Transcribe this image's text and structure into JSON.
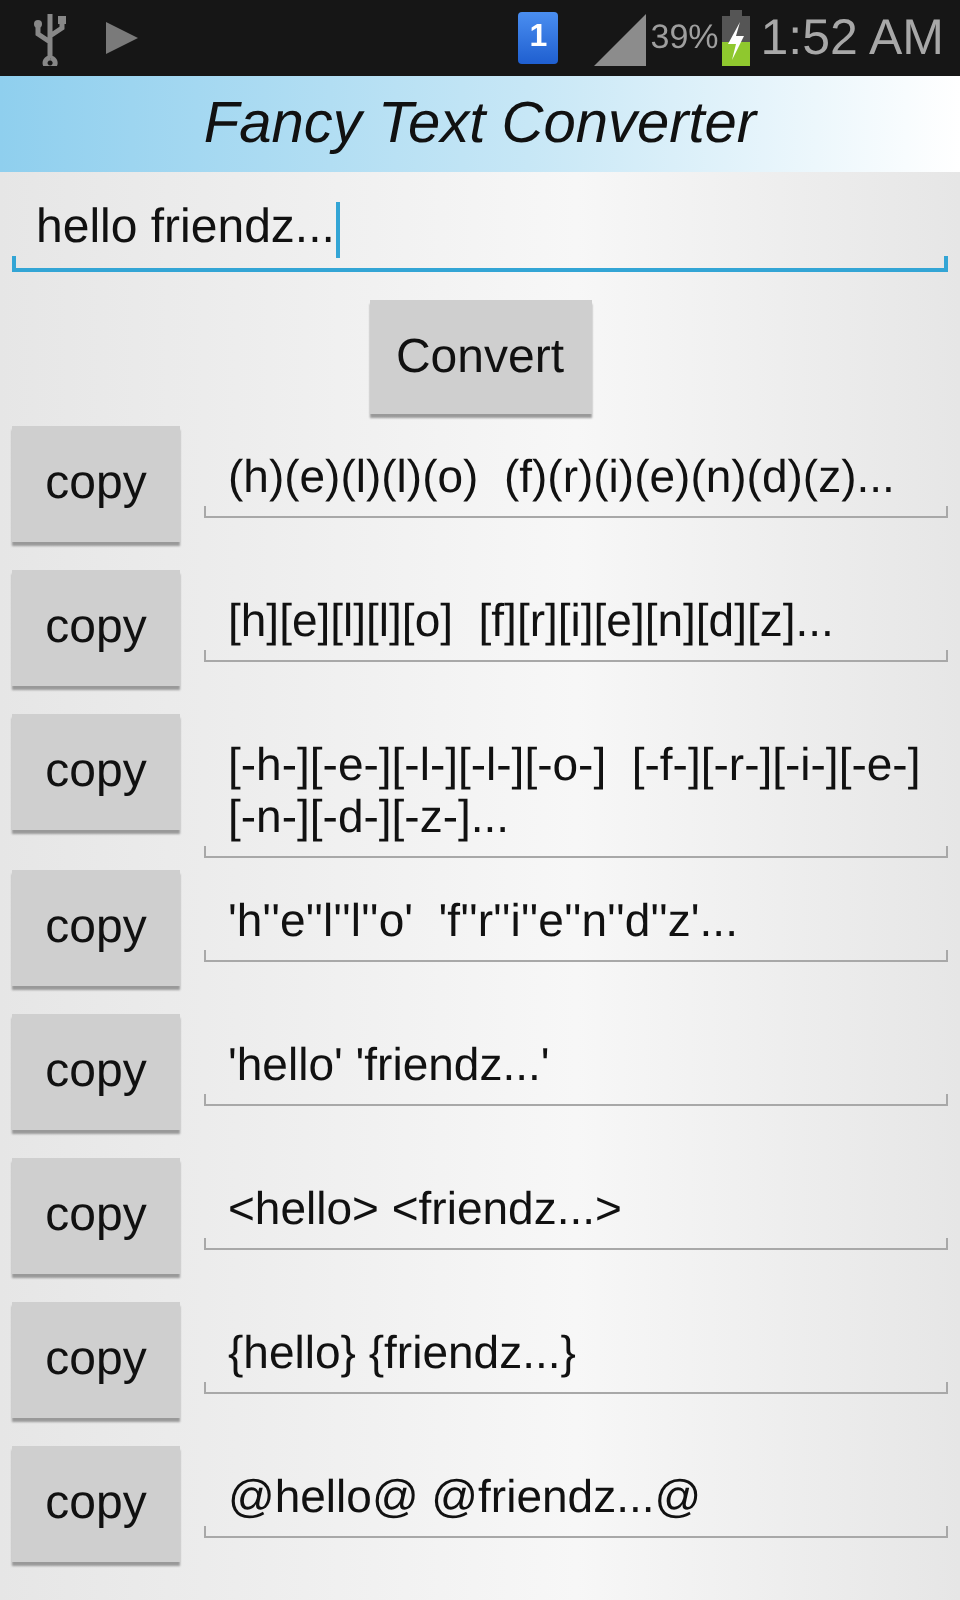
{
  "status_bar": {
    "notification_count": "1",
    "battery": "39%",
    "time": "1:52 AM"
  },
  "title": "Fancy Text Converter",
  "input": {
    "value": "hello friendz..."
  },
  "convert_button": "Convert",
  "results": [
    {
      "button": "copy",
      "text": "(h)(e)(l)(l)(o)  (f)(r)(i)(e)(n)(d)(z)..."
    },
    {
      "button": "copy",
      "text": "[h][e][l][l][o]  [f][r][i][e][n][d][z]..."
    },
    {
      "button": "copy",
      "text": "[-h-][-e-][-l-][-l-][-o-]  [-f-][-r-][-i-][-e-][-n-][-d-][-z-]..."
    },
    {
      "button": "copy",
      "text": "'h''e''l''l''o'  'f''r''i''e''n''d''z'..."
    },
    {
      "button": "copy",
      "text": "'hello' 'friendz...'"
    },
    {
      "button": "copy",
      "text": "<hello> <friendz...>"
    },
    {
      "button": "copy",
      "text": "{hello} {friendz...}"
    },
    {
      "button": "copy",
      "text": "@hello@ @friendz...@"
    }
  ]
}
